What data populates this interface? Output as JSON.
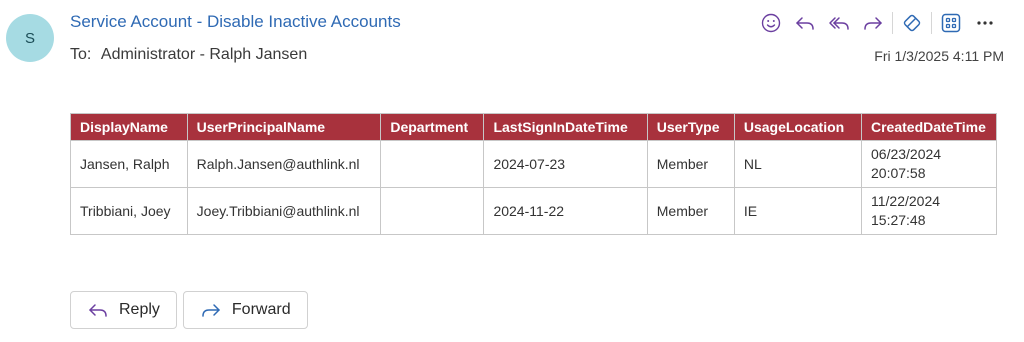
{
  "header": {
    "avatar_initial": "S",
    "subject": "Service Account - Disable Inactive Accounts",
    "to_label": "To:",
    "to_value": "Administrator - Ralph Jansen",
    "date": "Fri 1/3/2025 4:11 PM"
  },
  "toolbar": {
    "icons": [
      "smiley-icon",
      "reply-icon",
      "reply-all-icon",
      "forward-icon",
      "immersive-reader-icon",
      "apps-icon",
      "more-icon"
    ]
  },
  "table": {
    "columns": [
      "DisplayName",
      "UserPrincipalName",
      "Department",
      "LastSignInDateTime",
      "UserType",
      "UsageLocation",
      "CreatedDateTime"
    ],
    "rows": [
      [
        "Jansen, Ralph",
        "Ralph.Jansen@authlink.nl",
        "",
        "2024-07-23",
        "Member",
        "NL",
        "06/23/2024 20:07:58"
      ],
      [
        "Tribbiani, Joey",
        "Joey.Tribbiani@authlink.nl",
        "",
        "2024-11-22",
        "Member",
        "IE",
        "11/22/2024 15:27:48"
      ]
    ]
  },
  "actions": {
    "reply_label": "Reply",
    "forward_label": "Forward"
  },
  "colors": {
    "accent": "#2f6ab4",
    "icon": "#6b3fa0",
    "table_header": "#a8323d",
    "avatar_bg": "#a6dbe3"
  }
}
